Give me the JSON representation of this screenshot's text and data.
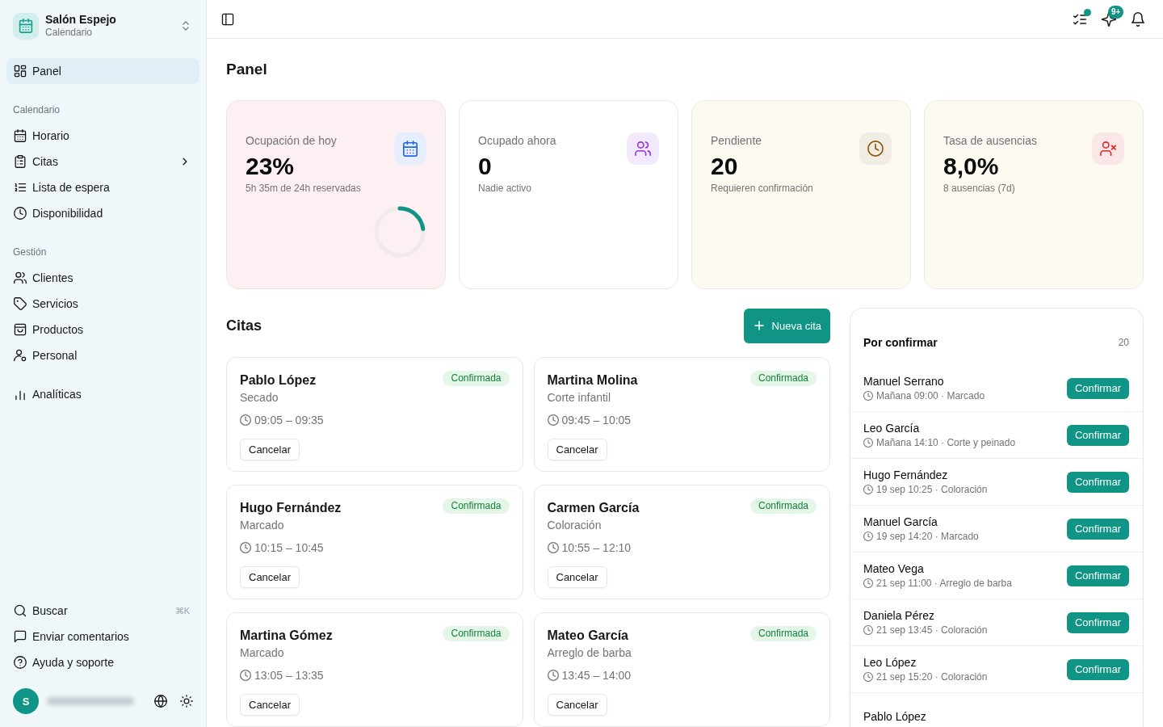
{
  "sidebar": {
    "workspace": {
      "name": "Salón Espejo",
      "subtitle": "Calendario"
    },
    "sections": [
      {
        "items": [
          {
            "label": "Panel",
            "selected": true,
            "has_submenu": false
          }
        ]
      },
      {
        "heading": "Calendario",
        "items": [
          {
            "label": "Horario",
            "selected": false,
            "has_submenu": false
          },
          {
            "label": "Citas",
            "selected": false,
            "has_submenu": true
          },
          {
            "label": "Lista de espera",
            "selected": false,
            "has_submenu": false
          },
          {
            "label": "Disponibilidad",
            "selected": false,
            "has_submenu": false
          }
        ]
      },
      {
        "heading": "Gestión",
        "items": [
          {
            "label": "Clientes",
            "selected": false,
            "has_submenu": false
          },
          {
            "label": "Servicios",
            "selected": false,
            "has_submenu": false
          },
          {
            "label": "Productos",
            "selected": false,
            "has_submenu": false
          },
          {
            "label": "Personal",
            "selected": false,
            "has_submenu": false
          }
        ]
      },
      {
        "items": [
          {
            "label": "Analíticas",
            "selected": false,
            "has_submenu": false
          }
        ]
      }
    ],
    "footer_items": [
      {
        "label": "Buscar",
        "shortcut": "⌘K"
      },
      {
        "label": "Enviar comentarios"
      },
      {
        "label": "Ayuda y soporte"
      }
    ],
    "user": {
      "initial": "S"
    }
  },
  "topbar": {
    "actions": [
      {
        "unread_dot": true
      },
      {
        "unread_dot": false,
        "badge": "9+"
      },
      {
        "unread_dot": false
      }
    ]
  },
  "page_title": "Panel",
  "stats": [
    {
      "label": "Ocupación de hoy",
      "value": "23%",
      "detail": "5h 35m de 24h reservadas",
      "kind": "rose",
      "color": "#2563eb",
      "level": 0.23
    },
    {
      "label": "Ocupado ahora",
      "value": "0",
      "detail": "Nadie activo",
      "kind": "plain",
      "color": "#9333ea"
    },
    {
      "label": "Pendiente",
      "value": "20",
      "detail": "Requieren confirmación",
      "kind": "cream",
      "color": "#8a5a06"
    },
    {
      "label": "Tasa de ausencias",
      "value": "8,0%",
      "detail": "8 ausencias (7d)",
      "kind": "cream",
      "color": "#dc2626"
    }
  ],
  "appointments": {
    "title": "Citas",
    "new_button": "Nueva cita",
    "items": [
      {
        "client": "Pablo López",
        "service": "Secado",
        "time": "09:05 – 09:35",
        "status": "Confirmada",
        "cancel": "Cancelar"
      },
      {
        "client": "Martina Molina",
        "service": "Corte infantil",
        "time": "09:45 – 10:05",
        "status": "Confirmada",
        "cancel": "Cancelar"
      },
      {
        "client": "Hugo Fernández",
        "service": "Marcado",
        "time": "10:15 – 10:45",
        "status": "Confirmada",
        "cancel": "Cancelar"
      },
      {
        "client": "Carmen García",
        "service": "Coloración",
        "time": "10:55 – 12:10",
        "status": "Confirmada",
        "cancel": "Cancelar"
      },
      {
        "client": "Martina Gómez",
        "service": "Marcado",
        "time": "13:05 – 13:35",
        "status": "Confirmada",
        "cancel": "Cancelar"
      },
      {
        "client": "Mateo García",
        "service": "Arreglo de barba",
        "time": "13:45 – 14:00",
        "status": "Confirmada",
        "cancel": "Cancelar"
      }
    ]
  },
  "pending": {
    "title": "Por confirmar",
    "count": "20",
    "items": [
      {
        "client": "Manuel Serrano",
        "meta": "Mañana 09:00 · Marcado",
        "action": "Confirmar"
      },
      {
        "client": "Leo García",
        "meta": "Mañana 14:10 · Corte y peinado",
        "action": "Confirmar"
      },
      {
        "client": "Hugo Fernández",
        "meta": "19 sep 10:25 · Coloración",
        "action": "Confirmar"
      },
      {
        "client": "Manuel García",
        "meta": "19 sep 14:20 · Marcado",
        "action": "Confirmar"
      },
      {
        "client": "Mateo Vega",
        "meta": "21 sep 11:00 · Arreglo de barba",
        "action": "Confirmar"
      },
      {
        "client": "Daniela Pérez",
        "meta": "21 sep 13:45 · Coloración",
        "action": "Confirmar"
      },
      {
        "client": "Leo López",
        "meta": "21 sep 15:20 · Coloración",
        "action": "Confirmar"
      },
      {
        "client": "Pablo López"
      }
    ]
  }
}
